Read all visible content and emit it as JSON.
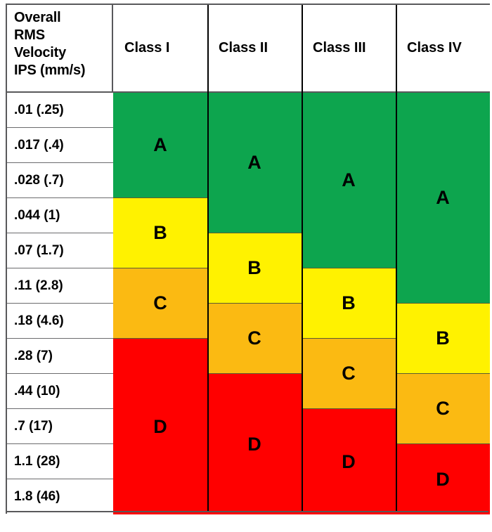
{
  "table": {
    "corner_header_lines": [
      "Overall",
      "RMS",
      "Velocity",
      "IPS (mm/s)"
    ],
    "corner_header_text": "Overall RMS Velocity IPS (mm/s)",
    "columns": [
      {
        "key": "class1",
        "label": "Class I"
      },
      {
        "key": "class2",
        "label": "Class II"
      },
      {
        "key": "class3",
        "label": "Class III"
      },
      {
        "key": "class4",
        "label": "Class IV"
      }
    ],
    "rows": [
      {
        "ips": ".01",
        "mms": "(.25)",
        "label": ".01  (.25)"
      },
      {
        "ips": ".017",
        "mms": "(.4)",
        "label": ".017  (.4)"
      },
      {
        "ips": ".028",
        "mms": "(.7)",
        "label": ".028  (.7)"
      },
      {
        "ips": ".044",
        "mms": "(1)",
        "label": ".044  (1)"
      },
      {
        "ips": ".07",
        "mms": "(1.7)",
        "label": ".07  (1.7)"
      },
      {
        "ips": ".11",
        "mms": "(2.8)",
        "label": ".11  (2.8)"
      },
      {
        "ips": ".18",
        "mms": "(4.6)",
        "label": ".18  (4.6)"
      },
      {
        "ips": ".28",
        "mms": "(7)",
        "label": ".28  (7)"
      },
      {
        "ips": ".44",
        "mms": "(10)",
        "label": ".44  (10)"
      },
      {
        "ips": ".7",
        "mms": "(17)",
        "label": ".7  (17)"
      },
      {
        "ips": "1.1",
        "mms": "(28)",
        "label": "1.1 (28)"
      },
      {
        "ips": "1.8",
        "mms": "(46)",
        "label": "1.8 (46)"
      }
    ]
  },
  "zone_colors": {
    "A": "#0DA54E",
    "B": "#FFF200",
    "C": "#FBBA12",
    "D": "#FF0000"
  },
  "chart_data": {
    "type": "heatmap",
    "title": "Overall RMS Velocity IPS (mm/s) vibration severity by machine class",
    "xlabel": "",
    "ylabel": "Overall RMS Velocity IPS (mm/s)",
    "categories": [
      "Class I",
      "Class II",
      "Class III",
      "Class IV"
    ],
    "y_tick_labels": [
      ".01  (.25)",
      ".017  (.4)",
      ".028  (.7)",
      ".044  (1)",
      ".07  (1.7)",
      ".11  (2.8)",
      ".18  (4.6)",
      ".28  (7)",
      ".44  (10)",
      ".7  (17)",
      "1.1 (28)",
      "1.8 (46)"
    ],
    "y_values_ips": [
      0.01,
      0.017,
      0.028,
      0.044,
      0.07,
      0.11,
      0.18,
      0.28,
      0.44,
      0.7,
      1.1,
      1.8
    ],
    "y_values_mms": [
      0.25,
      0.4,
      0.7,
      1.0,
      1.7,
      2.8,
      4.6,
      7.0,
      10.0,
      17.0,
      28.0,
      46.0
    ],
    "grid": true,
    "legend": "none",
    "zone_order": [
      "A",
      "B",
      "C",
      "D"
    ],
    "series": [
      {
        "name": "Class I",
        "zones": [
          {
            "zone": "A",
            "start_row": 1,
            "end_row": 3,
            "color": "#0DA54E"
          },
          {
            "zone": "B",
            "start_row": 4,
            "end_row": 5,
            "color": "#FFF200"
          },
          {
            "zone": "C",
            "start_row": 6,
            "end_row": 7,
            "color": "#FBBA12"
          },
          {
            "zone": "D",
            "start_row": 8,
            "end_row": 12,
            "color": "#FF0000"
          }
        ]
      },
      {
        "name": "Class II",
        "zones": [
          {
            "zone": "A",
            "start_row": 1,
            "end_row": 4,
            "color": "#0DA54E"
          },
          {
            "zone": "B",
            "start_row": 5,
            "end_row": 6,
            "color": "#FFF200"
          },
          {
            "zone": "C",
            "start_row": 7,
            "end_row": 8,
            "color": "#FBBA12"
          },
          {
            "zone": "D",
            "start_row": 9,
            "end_row": 12,
            "color": "#FF0000"
          }
        ]
      },
      {
        "name": "Class III",
        "zones": [
          {
            "zone": "A",
            "start_row": 1,
            "end_row": 5,
            "color": "#0DA54E"
          },
          {
            "zone": "B",
            "start_row": 6,
            "end_row": 7,
            "color": "#FFF200"
          },
          {
            "zone": "C",
            "start_row": 8,
            "end_row": 9,
            "color": "#FBBA12"
          },
          {
            "zone": "D",
            "start_row": 10,
            "end_row": 12,
            "color": "#FF0000"
          }
        ]
      },
      {
        "name": "Class IV",
        "zones": [
          {
            "zone": "A",
            "start_row": 1,
            "end_row": 6,
            "color": "#0DA54E"
          },
          {
            "zone": "B",
            "start_row": 7,
            "end_row": 8,
            "color": "#FFF200"
          },
          {
            "zone": "C",
            "start_row": 9,
            "end_row": 10,
            "color": "#FBBA12"
          },
          {
            "zone": "D",
            "start_row": 11,
            "end_row": 12,
            "color": "#FF0000"
          }
        ]
      }
    ]
  }
}
